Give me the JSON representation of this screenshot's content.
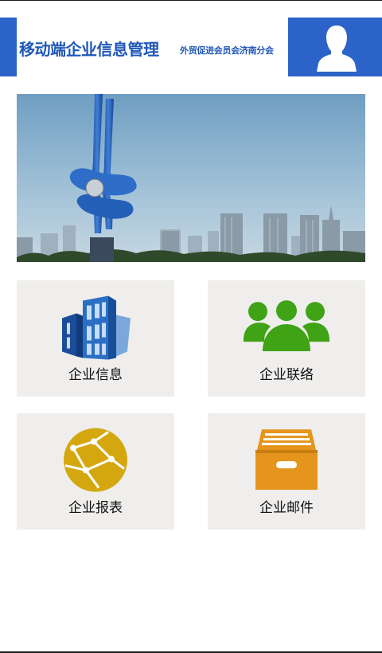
{
  "header": {
    "title": "移动端企业信息管理",
    "subtitle": "外贸促进会员会济南分会",
    "avatar_icon": "user-avatar-icon",
    "accent_color": "#2b63c8"
  },
  "banner": {
    "icon": "city-landmark-photo"
  },
  "tiles": [
    {
      "label": "企业信息",
      "icon": "building-icon",
      "color": "#2a6fc4"
    },
    {
      "label": "企业联络",
      "icon": "people-group-icon",
      "color": "#3fa315"
    },
    {
      "label": "企业报表",
      "icon": "network-globe-icon",
      "color": "#d4a70f"
    },
    {
      "label": "企业邮件",
      "icon": "archive-box-icon",
      "color": "#e5951c"
    }
  ]
}
